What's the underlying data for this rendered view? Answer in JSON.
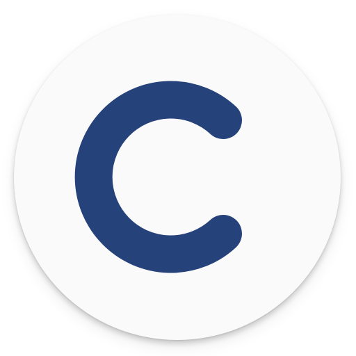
{
  "app_icon": {
    "icon": "c-letter-logo-icon",
    "background_color": "#fafafa",
    "glyph_color": "#26427a"
  }
}
